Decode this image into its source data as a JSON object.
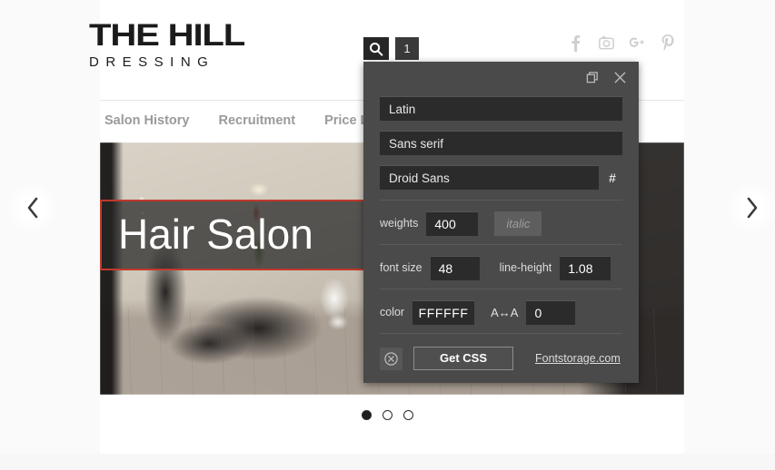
{
  "site": {
    "logo": {
      "main": "THE HILL",
      "sub": "DRESSING"
    },
    "nav": [
      {
        "label": "Salon History"
      },
      {
        "label": "Recruitment"
      },
      {
        "label": "Price List"
      }
    ],
    "social": [
      {
        "name": "facebook-icon"
      },
      {
        "name": "instagram-icon"
      },
      {
        "name": "google-plus-icon"
      },
      {
        "name": "pinterest-icon"
      }
    ],
    "hero": {
      "title": "Hair Salon",
      "prev_label": "‹",
      "next_label": "›",
      "dots": [
        {
          "active": true
        },
        {
          "active": false
        },
        {
          "active": false
        }
      ]
    }
  },
  "search_bar": {
    "search_icon": "search-icon",
    "count": "1"
  },
  "dialog": {
    "titlebar": {
      "restore_icon": "restore-window-icon",
      "close_icon": "close-icon"
    },
    "script_select": "Latin",
    "category_select": "Sans serif",
    "family_select": "Droid Sans",
    "hash_button": "#",
    "weights_label": "weights",
    "weights_value": "400",
    "italic_label": "italic",
    "font_size_label": "font size",
    "font_size_value": "48",
    "line_height_label": "line-height",
    "line_height_value": "1.08",
    "color_label": "color",
    "color_value": "FFFFFF",
    "tracking_label": "A↔A",
    "tracking_value": "0",
    "clear_icon": "circle-x-icon",
    "get_css_label": "Get CSS",
    "brand_link": "Fontstorage.com"
  },
  "colors": {
    "accent_red": "#C0392B",
    "dialog_bg": "#4A4A4A",
    "input_bg": "#2B2B2B",
    "page_bg": "#FAFAFA"
  }
}
